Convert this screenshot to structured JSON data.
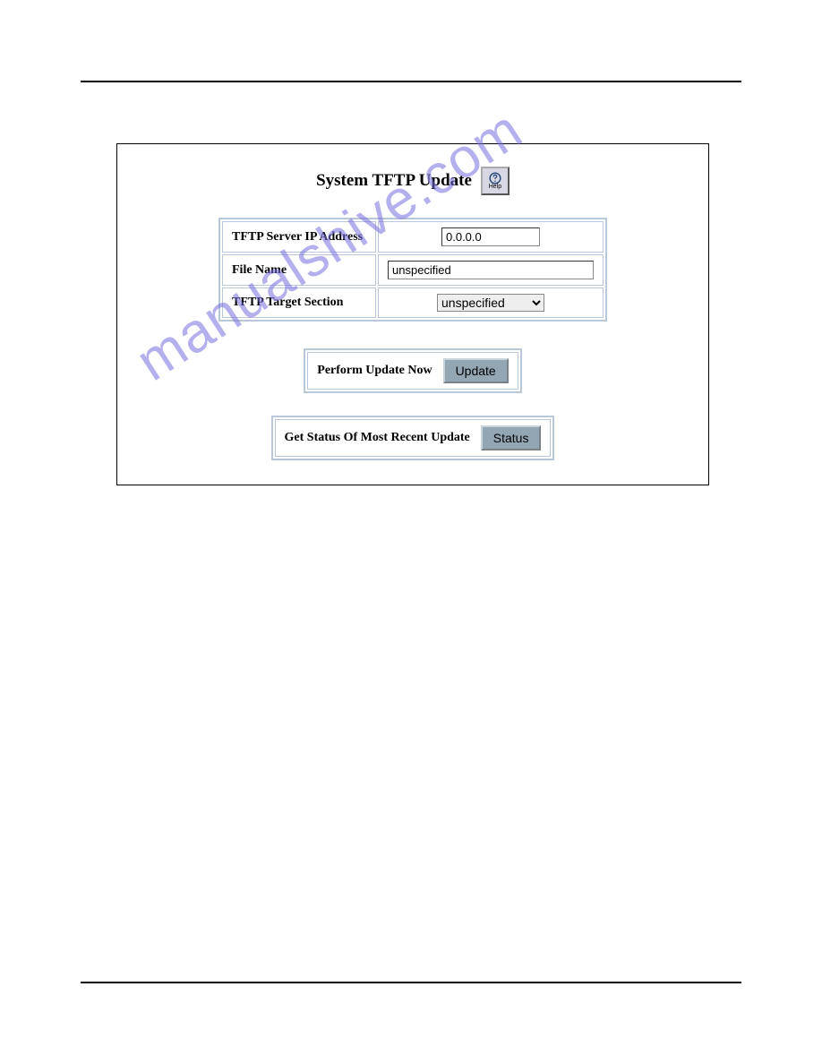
{
  "title": "System TFTP Update",
  "help_label": "Help",
  "fields": {
    "ip_label": "TFTP Server IP Address",
    "ip_value": "0.0.0.0",
    "filename_label": "File Name",
    "filename_value": "unspecified",
    "target_label": "TFTP Target Section",
    "target_value": "unspecified"
  },
  "actions": {
    "update_label": "Perform Update Now",
    "update_button": "Update",
    "status_label": "Get Status Of Most Recent Update",
    "status_button": "Status"
  },
  "watermark": "manualshive.com"
}
